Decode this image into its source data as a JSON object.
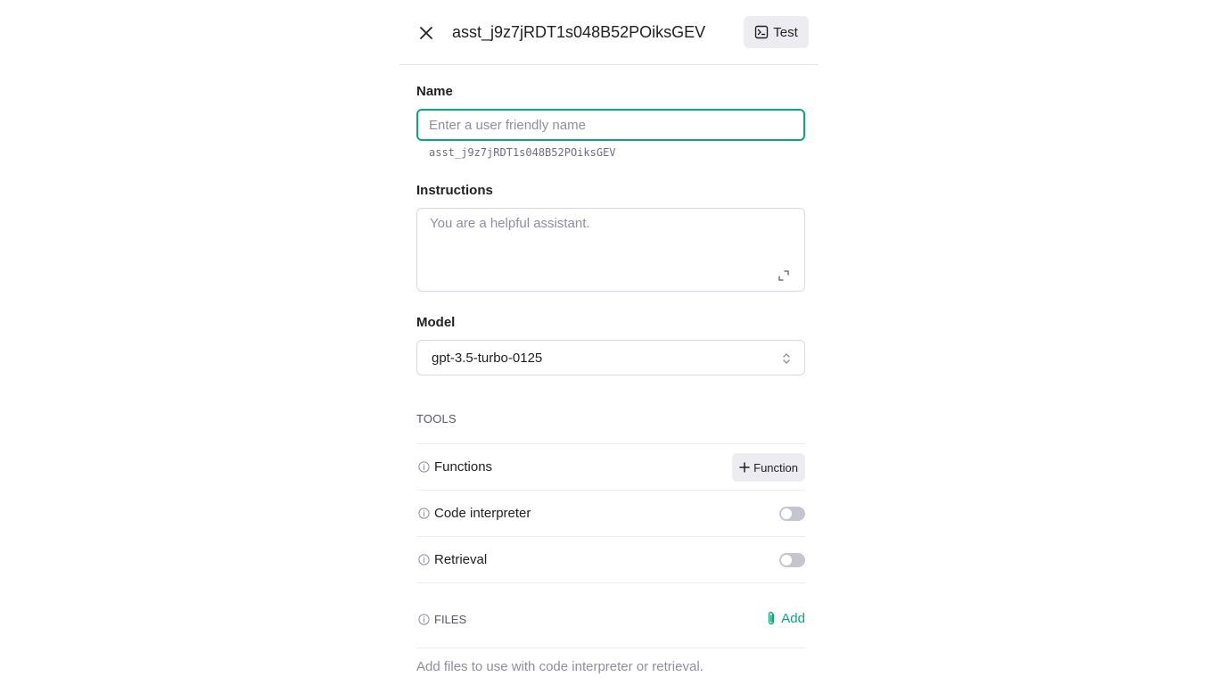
{
  "header": {
    "title": "asst_j9z7jRDT1s048B52POiksGEV",
    "test_label": "Test"
  },
  "form": {
    "name": {
      "label": "Name",
      "placeholder": "Enter a user friendly name",
      "value": "",
      "assistant_id": "asst_j9z7jRDT1s048B52POiksGEV"
    },
    "instructions": {
      "label": "Instructions",
      "placeholder": "You are a helpful assistant.",
      "value": ""
    },
    "model": {
      "label": "Model",
      "selected": "gpt-3.5-turbo-0125"
    }
  },
  "tools": {
    "heading": "TOOLS",
    "functions": {
      "label": "Functions",
      "add_label": "Function"
    },
    "code_interpreter": {
      "label": "Code interpreter",
      "enabled": false
    },
    "retrieval": {
      "label": "Retrieval",
      "enabled": false
    }
  },
  "files": {
    "heading": "FILES",
    "add_label": "Add",
    "hint": "Add files to use with code interpreter or retrieval."
  },
  "colors": {
    "accent": "#10a37f",
    "toggle_off": "#c5c5d2",
    "button_bg": "#ececf1"
  },
  "icons": {
    "close": "close-icon",
    "test": "terminal-icon",
    "expand": "expand-icon",
    "select": "chevron-up-down-icon",
    "info": "info-icon",
    "plus": "plus-icon",
    "attach": "paperclip-icon"
  }
}
